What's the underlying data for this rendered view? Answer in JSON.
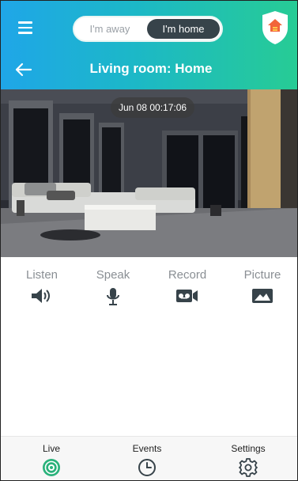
{
  "header": {
    "mode_toggle": {
      "away_label": "I'm away",
      "home_label": "I'm home"
    },
    "page_title": "Living room: Home"
  },
  "camera": {
    "timestamp": "Jun 08 00:17:06"
  },
  "actions": [
    {
      "label": "Listen",
      "icon": "speaker-icon"
    },
    {
      "label": "Speak",
      "icon": "microphone-icon"
    },
    {
      "label": "Record",
      "icon": "record-icon"
    },
    {
      "label": "Picture",
      "icon": "picture-icon"
    }
  ],
  "bottom_nav": [
    {
      "label": "Live",
      "icon": "live-icon",
      "active": true
    },
    {
      "label": "Events",
      "icon": "clock-icon",
      "active": false
    },
    {
      "label": "Settings",
      "icon": "gear-icon",
      "active": false
    }
  ],
  "colors": {
    "header_gradient_start": "#1fa6e8",
    "header_gradient_end": "#27cc94",
    "active_accent": "#2ab27b",
    "toggle_active_bg": "#37434a"
  }
}
